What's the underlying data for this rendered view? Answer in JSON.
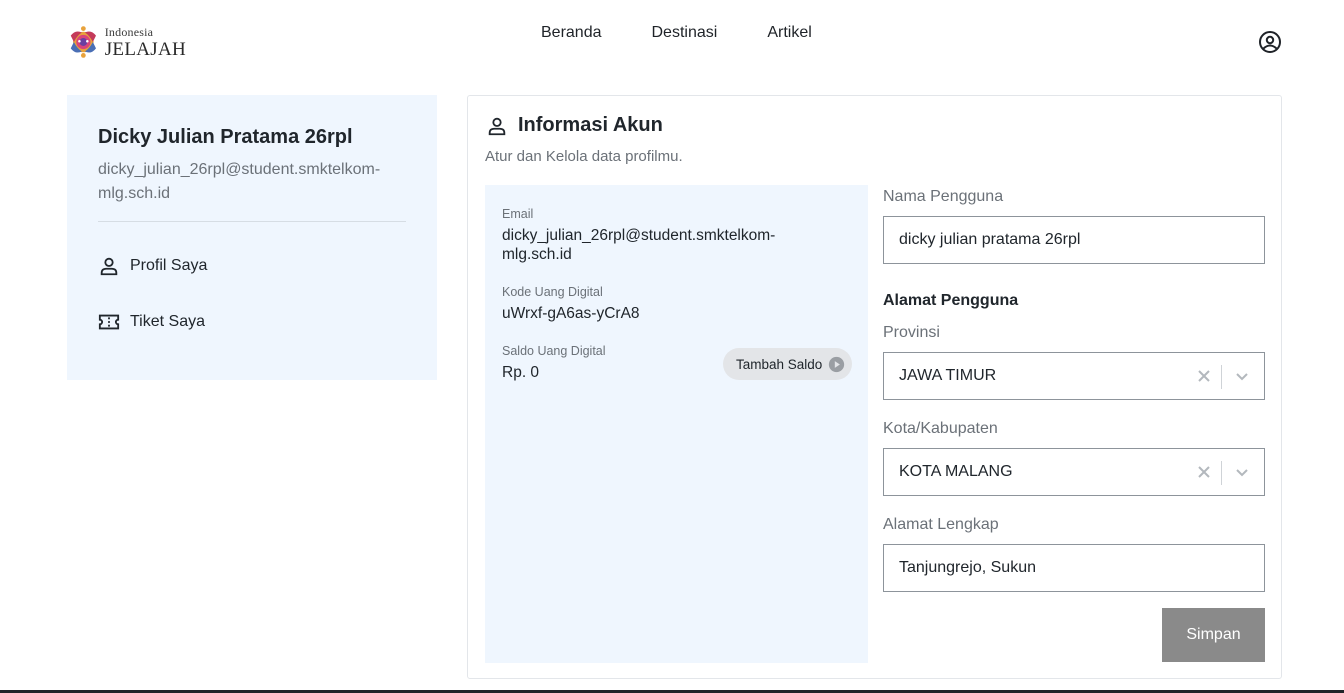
{
  "brand": {
    "line1": "Indonesia",
    "line2": "JELAJAH"
  },
  "nav": {
    "items": [
      "Beranda",
      "Destinasi",
      "Artikel"
    ]
  },
  "sidebar": {
    "name": "Dicky Julian Pratama 26rpl",
    "email": "dicky_julian_26rpl@student.smktelkom-mlg.sch.id",
    "menu": [
      {
        "label": "Profil Saya",
        "icon": "person-icon"
      },
      {
        "label": "Tiket Saya",
        "icon": "ticket-icon"
      }
    ]
  },
  "account": {
    "title": "Informasi Akun",
    "subtitle": "Atur dan Kelola data profilmu.",
    "email_label": "Email",
    "email_value": "dicky_julian_26rpl@student.smktelkom-mlg.sch.id",
    "code_label": "Kode Uang Digital",
    "code_value": "uWrxf-gA6as-yCrA8",
    "balance_label": "Saldo Uang Digital",
    "balance_value": "Rp. 0",
    "topup_button": "Tambah Saldo"
  },
  "form": {
    "username_label": "Nama Pengguna",
    "username_value": "dicky julian pratama 26rpl",
    "address_heading": "Alamat Pengguna",
    "province_label": "Provinsi",
    "province_value": "JAWA TIMUR",
    "city_label": "Kota/Kabupaten",
    "city_value": "KOTA MALANG",
    "full_address_label": "Alamat Lengkap",
    "full_address_value": "Tanjungrejo, Sukun",
    "save_button": "Simpan"
  },
  "colors": {
    "panel_bg": "#eff6fe",
    "save_button_bg": "#8a8a8a",
    "topup_button_bg": "#e3e5e8"
  }
}
